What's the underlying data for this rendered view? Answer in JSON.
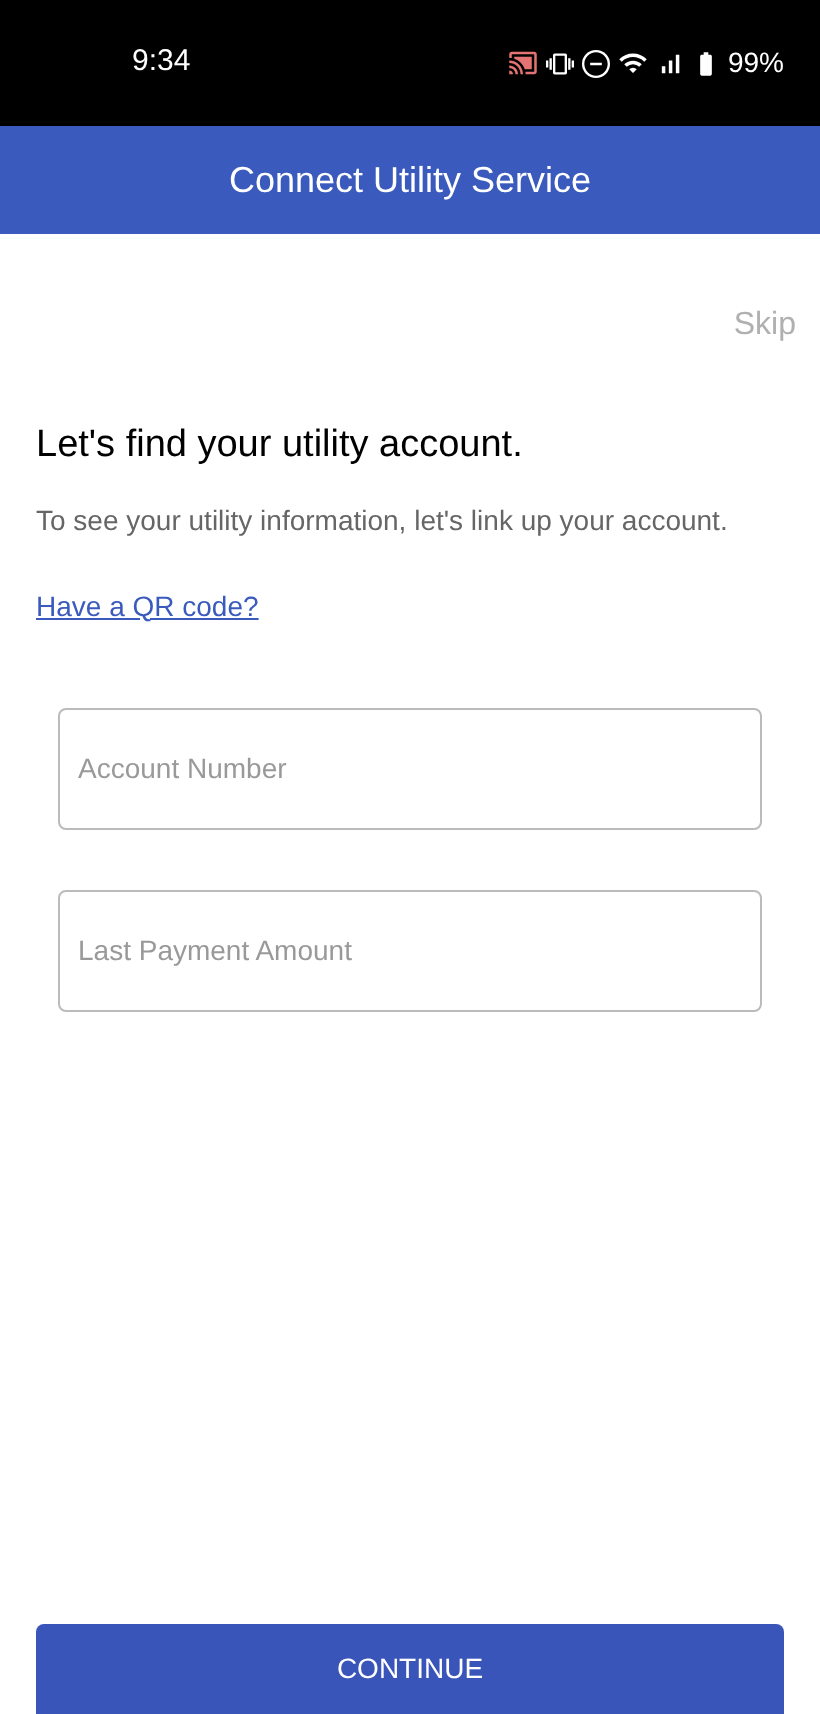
{
  "status_bar": {
    "time": "9:34",
    "battery": "99%"
  },
  "header": {
    "title": "Connect Utility Service"
  },
  "skip": "Skip",
  "heading": "Let's find your utility account.",
  "description": "To see your utility information, let's link up your account.",
  "qr_link": "Have a QR code?",
  "fields": [
    {
      "placeholder": "Account Number"
    },
    {
      "placeholder": "Last Payment Amount"
    }
  ],
  "continue_button": "CONTINUE"
}
